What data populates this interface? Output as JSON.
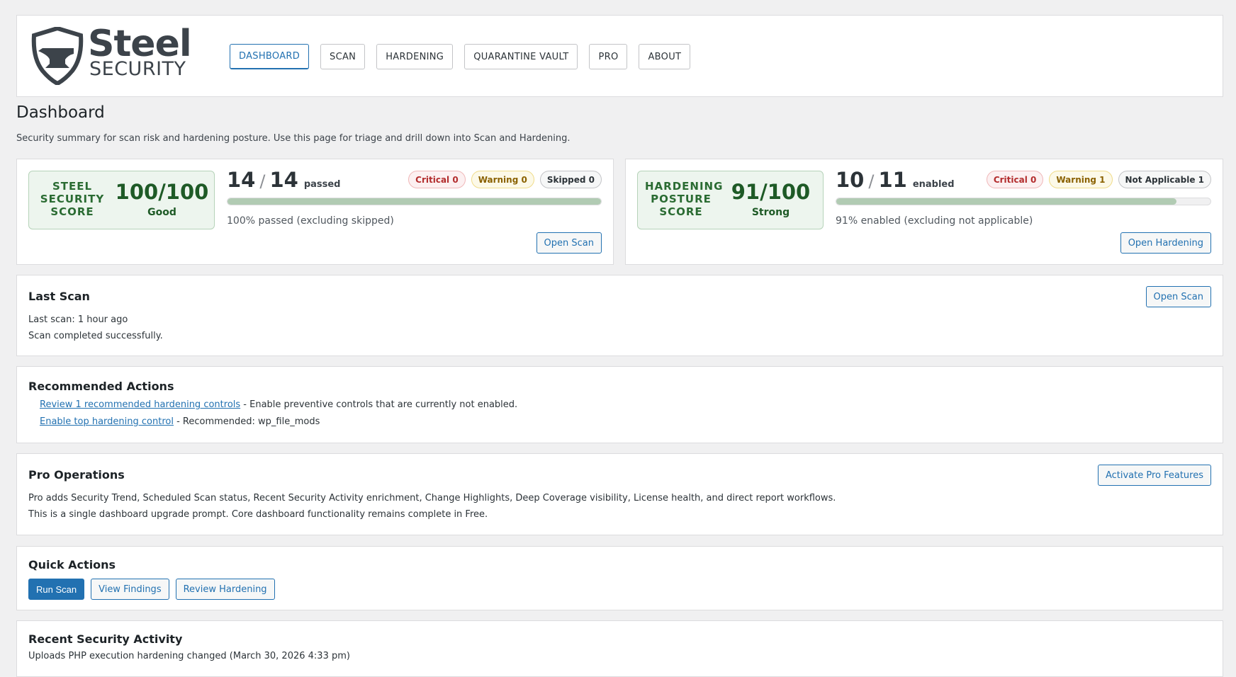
{
  "brand": {
    "word1": "Steel",
    "word2": "SECURITY"
  },
  "nav": {
    "tabs": [
      {
        "label": "DASHBOARD"
      },
      {
        "label": "SCAN"
      },
      {
        "label": "HARDENING"
      },
      {
        "label": "QUARANTINE VAULT"
      },
      {
        "label": "PRO"
      },
      {
        "label": "ABOUT"
      }
    ],
    "active_tab": "DASHBOARD"
  },
  "page": {
    "title": "Dashboard",
    "description": "Security summary for scan risk and hardening posture. Use this page for triage and drill down into Scan and Hardening."
  },
  "security_score": {
    "label": "STEEL SECURITY SCORE",
    "value": "100/100",
    "rating": "Good",
    "passed": "14",
    "total": "14",
    "separator": "/",
    "unit": "passed",
    "progress_percent": 100,
    "note": "100% passed (excluding skipped)",
    "badges": {
      "critical": "Critical 0",
      "warning": "Warning 0",
      "skipped": "Skipped 0"
    },
    "button": "Open Scan"
  },
  "hardening_score": {
    "label": "HARDENING POSTURE SCORE",
    "value": "91/100",
    "rating": "Strong",
    "enabled": "10",
    "total": "11",
    "separator": "/",
    "unit": "enabled",
    "progress_percent": 91,
    "note": "91% enabled (excluding not applicable)",
    "badges": {
      "critical": "Critical 0",
      "warning": "Warning 1",
      "not_applicable": "Not Applicable 1"
    },
    "button": "Open Hardening"
  },
  "last_scan": {
    "title": "Last Scan",
    "time": "Last scan: 1 hour ago",
    "status": "Scan completed successfully.",
    "button": "Open Scan"
  },
  "recommended": {
    "title": "Recommended Actions",
    "items": [
      {
        "link": "Review 1 recommended hardening controls",
        "text": " - Enable preventive controls that are currently not enabled."
      },
      {
        "link": "Enable top hardening control",
        "text": " - Recommended: wp_file_mods"
      }
    ]
  },
  "pro": {
    "title": "Pro Operations",
    "line1": "Pro adds Security Trend, Scheduled Scan status, Recent Security Activity enrichment, Change Highlights, Deep Coverage visibility, License health, and direct report workflows.",
    "line2": "This is a single dashboard upgrade prompt. Core dashboard functionality remains complete in Free.",
    "button": "Activate Pro Features"
  },
  "quick_actions": {
    "title": "Quick Actions",
    "run_scan": "Run Scan",
    "view_findings": "View Findings",
    "review_hardening": "Review Hardening"
  },
  "recent_activity": {
    "title": "Recent Security Activity",
    "first_item": "Uploads PHP execution hardening changed (March 30, 2026 4:33 pm)"
  },
  "colors": {
    "accent": "#2271b1",
    "success": "#1e5a26",
    "critical": "#b32d2e",
    "warning": "#8a6100"
  }
}
